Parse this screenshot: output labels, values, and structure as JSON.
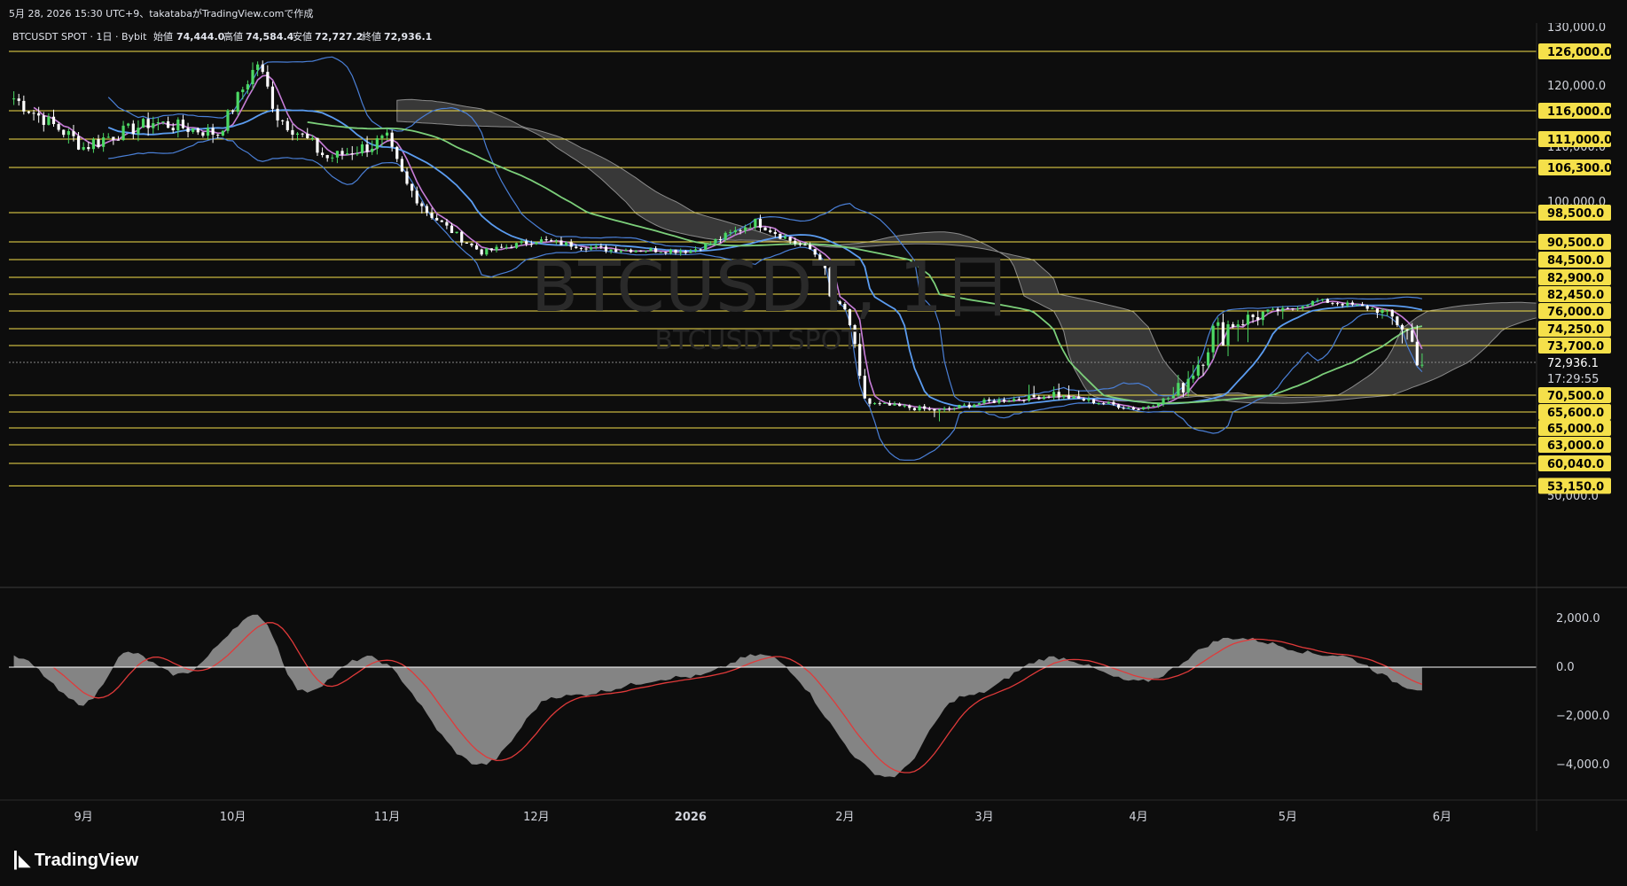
{
  "header": {
    "attribution": "5月 28, 2026 15:30 UTC+9、takatabaがTradingView.comで作成"
  },
  "legend": {
    "symbol": "BTCUSDT SPOT · 1日 · Bybit",
    "open_label": "始値",
    "open": "74,444.0",
    "high_label": "高値",
    "high": "74,584.4",
    "low_label": "安値",
    "low": "72,727.2",
    "close_label": "終値",
    "close": "72,936.1"
  },
  "watermark": {
    "main": "BTCUSDT, 1日",
    "sub": "BTCUSDT SPOT"
  },
  "price_axis": {
    "ticks": [
      "130,000.0",
      "120,000.0",
      "110,000.0",
      "100,000.0",
      "50,000.0"
    ]
  },
  "levels": [
    "126,000.0",
    "116,000.0",
    "111,000.0",
    "106,300.0",
    "98,500.0",
    "90,500.0",
    "84,500.0",
    "82,900.0",
    "82,450.0",
    "76,000.0",
    "74,250.0",
    "73,700.0",
    "70,500.0",
    "65,600.0",
    "65,000.0",
    "63,000.0",
    "60,040.0",
    "53,150.0"
  ],
  "last_price": {
    "value": "72,936.1",
    "countdown": "17:29:55"
  },
  "oscillator_axis": {
    "ticks": [
      "2,000.0",
      "0.0",
      "−2,000.0",
      "−4,000.0"
    ]
  },
  "time_axis": [
    "9月",
    "10月",
    "11月",
    "12月",
    "2026",
    "2月",
    "3月",
    "4月",
    "5月",
    "6月"
  ],
  "footer": {
    "brand": "TradingView"
  },
  "colors": {
    "background": "#0d0d0d",
    "up": "#4cd964",
    "down": "#ffffff",
    "level": "#f5e04a",
    "bollinger": "#4a7fd6",
    "ma_short": "#c77dd8",
    "ma_mid": "#5b9cf0",
    "ma_long": "#7ccf7a",
    "cloud": "#8a8a8a",
    "osc_hist": "#9a9a9a",
    "osc_signal": "#e03a3a"
  },
  "chart_data": {
    "type": "candlestick",
    "symbol": "BTCUSDT SPOT",
    "interval": "1日",
    "x_range": [
      "2025-08-17",
      "2026-06-20"
    ],
    "ylim": [
      50000,
      130000
    ],
    "price_series": {
      "name": "BTCUSDT",
      "x": [
        "2025-08-18",
        "2025-09-01",
        "2025-09-15",
        "2025-09-28",
        "2025-10-06",
        "2025-10-10",
        "2025-10-20",
        "2025-11-01",
        "2025-11-05",
        "2025-11-20",
        "2025-12-01",
        "2025-12-15",
        "2026-01-01",
        "2026-01-14",
        "2026-01-25",
        "2026-02-03",
        "2026-02-06",
        "2026-02-20",
        "2026-03-01",
        "2026-03-15",
        "2026-04-01",
        "2026-04-15",
        "2026-05-01",
        "2026-05-07",
        "2026-05-15",
        "2026-05-28"
      ],
      "values": [
        118000,
        110000,
        114000,
        112000,
        124000,
        115000,
        108000,
        111000,
        103000,
        87000,
        91000,
        88000,
        87500,
        96000,
        88000,
        73000,
        68000,
        66000,
        68500,
        70500,
        66500,
        74000,
        76500,
        80000,
        78000,
        72936
      ]
    },
    "oscillator": {
      "ylim": [
        -5000,
        3000
      ],
      "hist_x": [
        "2025-08-18",
        "2025-09-01",
        "2025-09-10",
        "2025-09-20",
        "2025-10-06",
        "2025-10-15",
        "2025-10-28",
        "2025-11-20",
        "2025-12-05",
        "2026-01-01",
        "2026-01-15",
        "2026-02-10",
        "2026-02-25",
        "2026-03-15",
        "2026-04-01",
        "2026-04-20",
        "2026-05-10",
        "2026-05-28"
      ],
      "hist_values": [
        400,
        -1500,
        600,
        -300,
        2100,
        -1000,
        400,
        -4000,
        -1200,
        -400,
        500,
        -4500,
        -1200,
        400,
        -600,
        1200,
        500,
        -900
      ]
    },
    "levels": [
      126000,
      116000,
      111000,
      106300,
      98500,
      90500,
      84500,
      82900,
      82450,
      76000,
      74250,
      73700,
      70500,
      65600,
      65000,
      63000,
      60040,
      53150
    ],
    "time_ticks": [
      "9月",
      "10月",
      "11月",
      "12月",
      "2026",
      "2月",
      "3月",
      "4月",
      "5月",
      "6月"
    ]
  }
}
